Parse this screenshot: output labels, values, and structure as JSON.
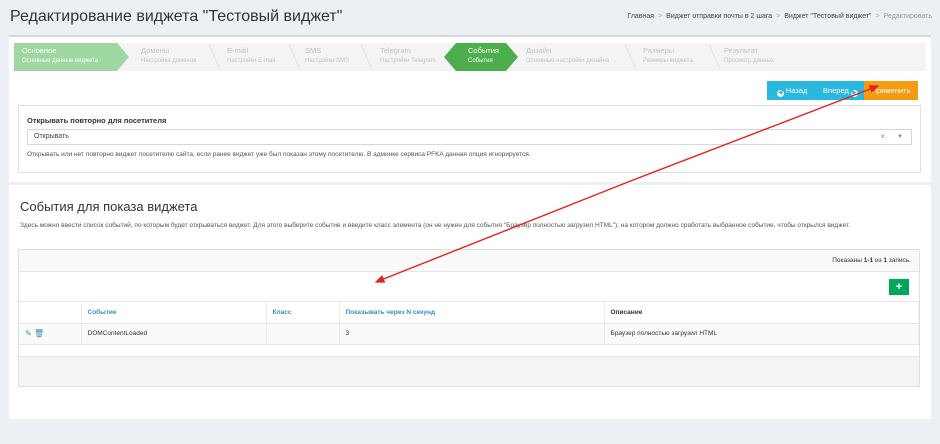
{
  "header": {
    "title": "Редактирование виджета \"Тестовый виджет\"",
    "breadcrumb": [
      "Главная",
      "Виджет отправки почты в 2 шага",
      "Виджет \"Тестовый виджет\"",
      "Редактировать"
    ]
  },
  "wizard": {
    "steps": [
      {
        "title": "Основное",
        "subtitle": "Основные данные виджета",
        "state": "done"
      },
      {
        "title": "Домены",
        "subtitle": "Настройка доменов",
        "state": "todo"
      },
      {
        "title": "E-mail",
        "subtitle": "Настройки E-mail",
        "state": "todo"
      },
      {
        "title": "SMS",
        "subtitle": "Настройки SMS",
        "state": "todo"
      },
      {
        "title": "Telegram",
        "subtitle": "Настройки Telegram",
        "state": "todo"
      },
      {
        "title": "События",
        "subtitle": "События",
        "state": "current"
      },
      {
        "title": "Дизайн",
        "subtitle": "Основные настройки дизайна",
        "state": "todo"
      },
      {
        "title": "Размеры",
        "subtitle": "Размеры виджета",
        "state": "todo"
      },
      {
        "title": "Результат",
        "subtitle": "Просмотр данных",
        "state": "todo"
      }
    ]
  },
  "actions": {
    "back": "Назад",
    "forward": "Вперед",
    "apply": "Применить"
  },
  "reopen": {
    "label": "Открывать повторно для посетителя",
    "value": "Открывать",
    "clear": "×",
    "help": "Открывать или нет повторно виджет посетителю сайта, если ранее виджет уже был показан этому посетителю. В админке сервиса PFKA данная опция игнорируется."
  },
  "events": {
    "title": "События для показа виджета",
    "description": "Здесь можно ввести список событий, по которым будет открываться виджет. Для этого выберите событие и введите класс элемента (он не нужен для события \"Браузер полностью загрузил HTML\"), на котором должно сработать выбранное событие, чтобы открылся виджет.",
    "summary": {
      "prefix": "Показаны ",
      "range": "1-1",
      "middle": " из ",
      "total": "1",
      "suffix": " запись."
    },
    "add_label": "+",
    "columns": [
      "Событие",
      "Класс",
      "Показывать через N секунд",
      "Описание"
    ],
    "rows": [
      {
        "event": "DOMContentLoaded",
        "class": "",
        "delay": "3",
        "description": "Браузер полностью загрузил HTML"
      }
    ]
  },
  "colors": {
    "step_done": "#9fd7a0",
    "step_current": "#4cae4c",
    "button_info": "#2bb8e0",
    "button_apply": "#f39c12",
    "button_add": "#00a65a",
    "link": "#3c8dbc",
    "annotation_arrow": "#e8211c"
  }
}
